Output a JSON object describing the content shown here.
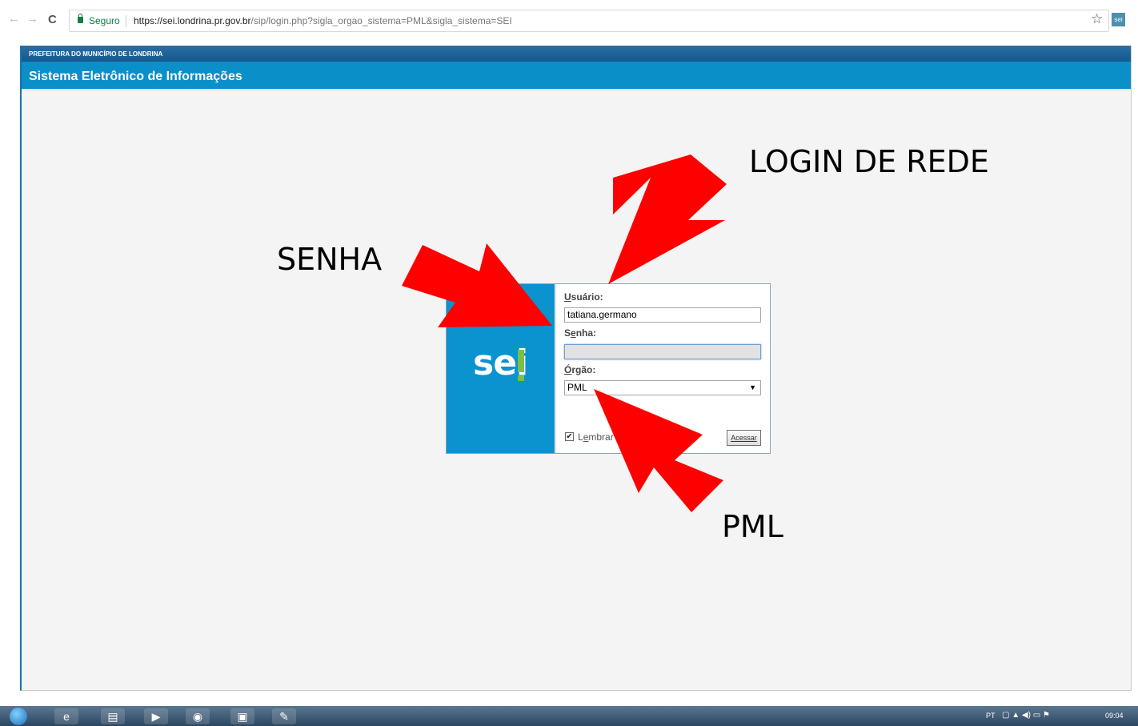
{
  "browser": {
    "secure_label": "Seguro",
    "url_host": "https://sei.londrina.pr.gov.br",
    "url_path": "/sip/login.php?sigla_orgao_sistema=PML&sigla_sistema=SEI",
    "back_icon": "←",
    "forward_icon": "→",
    "reload_icon": "C",
    "bookmark_icon": "☆",
    "extension_label": "sei"
  },
  "header": {
    "org_title": "PREFEITURA DO MUNICÍPIO DE LONDRINA",
    "system_title": "Sistema Eletrônico de Informações"
  },
  "login": {
    "logo_text": "sei",
    "user_label_first": "U",
    "user_label_rest": "suário:",
    "user_value": "tatiana.germano",
    "password_label_first": "S",
    "password_label_mid": "e",
    "password_label_rest": "nha:",
    "password_value": "",
    "org_label_first": "Ó",
    "org_label_rest": "rgão:",
    "org_selected": "PML",
    "remember_label_pre": "L",
    "remember_label_u": "e",
    "remember_label_rest": "mbrar",
    "remember_checked": "✔",
    "submit_label": "Acessar"
  },
  "annotations": {
    "login_de_rede": "LOGIN DE REDE",
    "senha": "SENHA",
    "pml": "PML",
    "arrow_color": "#ff0000"
  },
  "taskbar": {
    "language": "PT",
    "clock": "09:04"
  },
  "colors": {
    "header_dark": "#13588f",
    "header_light": "#0a8fc9",
    "logo_blue": "#0a93cf",
    "logo_green": "#7bc043"
  }
}
